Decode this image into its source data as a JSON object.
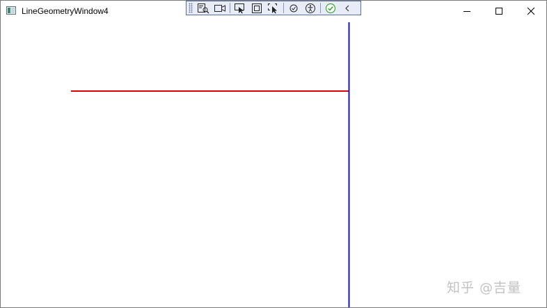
{
  "window": {
    "title": "LineGeometryWindow4",
    "icon": "wpf-window-icon",
    "controls": [
      "minimize-icon",
      "maximize-icon",
      "close-icon"
    ]
  },
  "debug_toolbar": {
    "icons": [
      "live-visual-tree-icon",
      "record-icon",
      "select-element-icon",
      "display-layout-adorners-icon",
      "track-focused-element-icon",
      "binding-failures-icon",
      "accessibility-icon",
      "check-icon",
      "collapse-chevron-icon"
    ],
    "colors": {
      "background": "#e8ecf7",
      "border": "#5a6ea0",
      "check": "#3aa832"
    }
  },
  "canvas": {
    "lines": [
      {
        "name": "red-line",
        "color": "#d40000"
      },
      {
        "name": "blue-line",
        "color": "#1414b4"
      }
    ]
  },
  "watermark": {
    "text": "知乎 @吉量"
  }
}
